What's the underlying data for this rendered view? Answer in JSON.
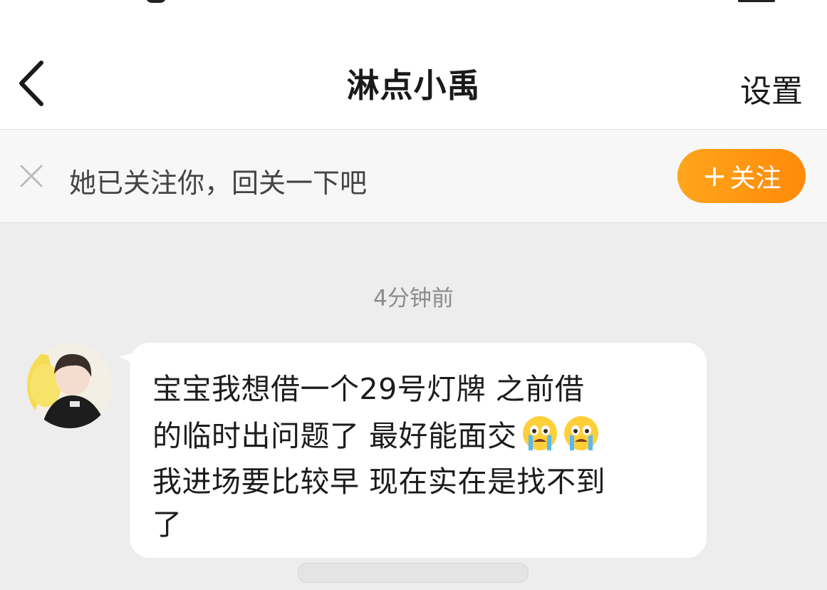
{
  "header": {
    "title": "淋点小禹",
    "settings_label": "设置"
  },
  "follow_prompt": {
    "text": "她已关注你，回关一下吧",
    "button_label": "关注",
    "button_plus": "+"
  },
  "chat": {
    "timestamp": "4分钟前",
    "message": {
      "lines": [
        "宝宝我想借一个29号灯牌 之前借",
        "的临时出问题了 最好能面交",
        "我进场要比较早 现在实在是找不到",
        "了"
      ],
      "emoji": "crying-emoji"
    }
  },
  "colors": {
    "accent_orange": "#ff8a0a",
    "background": "#ededed",
    "bubble": "#ffffff"
  }
}
